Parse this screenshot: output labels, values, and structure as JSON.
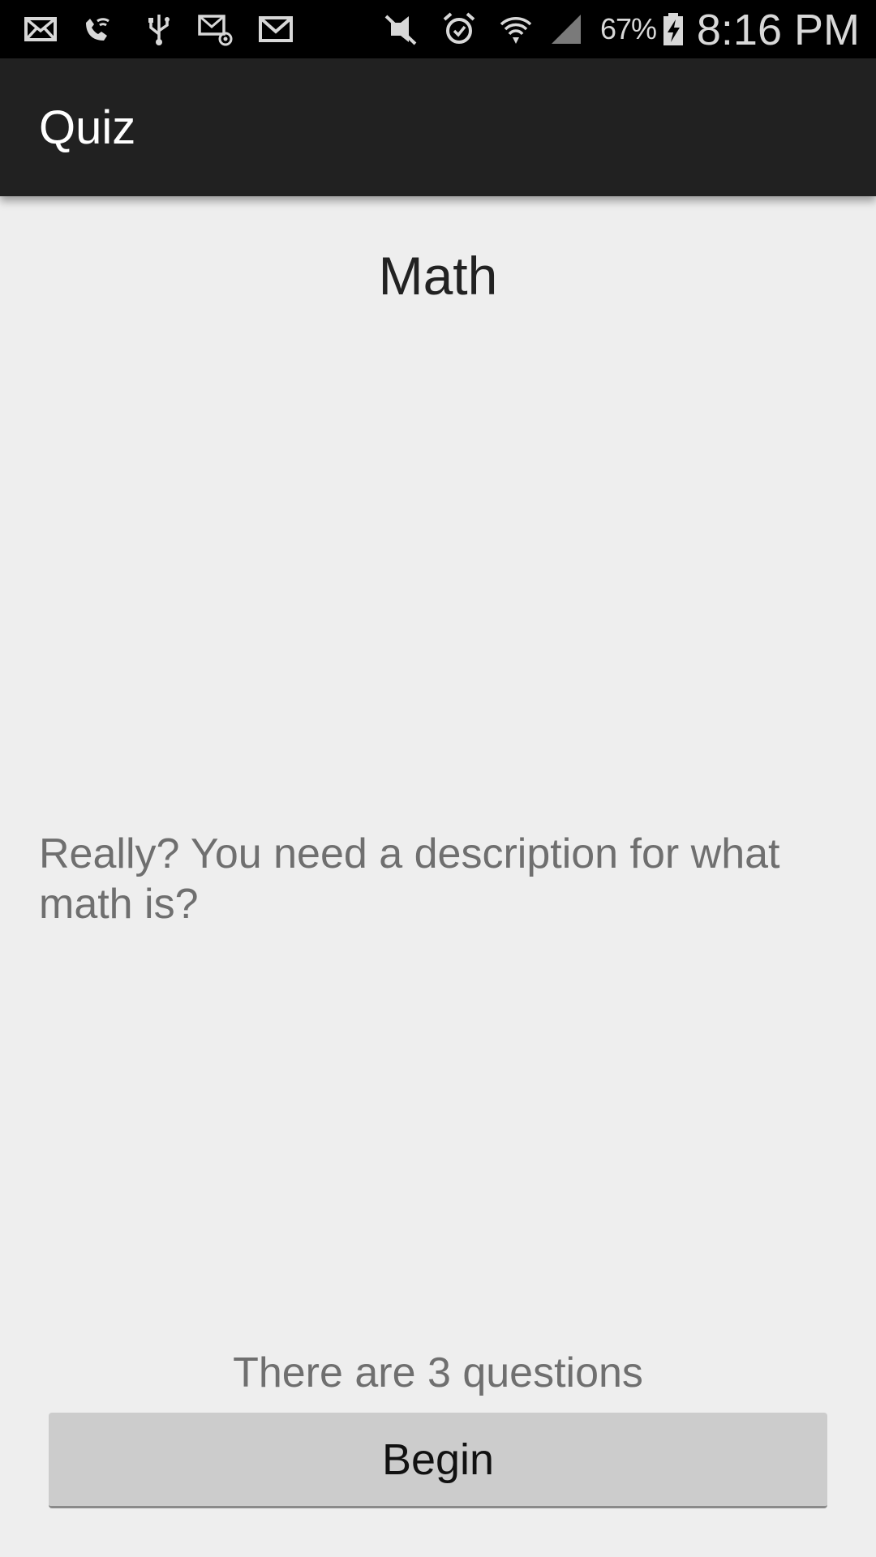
{
  "status_bar": {
    "left_icons": [
      "email-icon",
      "wifi-calling-icon",
      "usb-icon",
      "email-at-icon",
      "gmail-icon"
    ],
    "right_icons": [
      "vibrate-off-icon",
      "alarm-icon",
      "wifi-icon",
      "cell-signal-icon",
      "battery-charging-icon"
    ],
    "battery_percent": "67%",
    "time": "8:16 PM"
  },
  "action_bar": {
    "title": "Quiz"
  },
  "quiz": {
    "title": "Math",
    "description": "Really? You need a description for what math is?",
    "question_count_text": "There are 3 questions",
    "begin_label": "Begin"
  },
  "colors": {
    "status_bar_bg": "#000000",
    "action_bar_bg": "#212121",
    "content_bg": "#eeeeee",
    "button_bg": "#cccccc"
  }
}
